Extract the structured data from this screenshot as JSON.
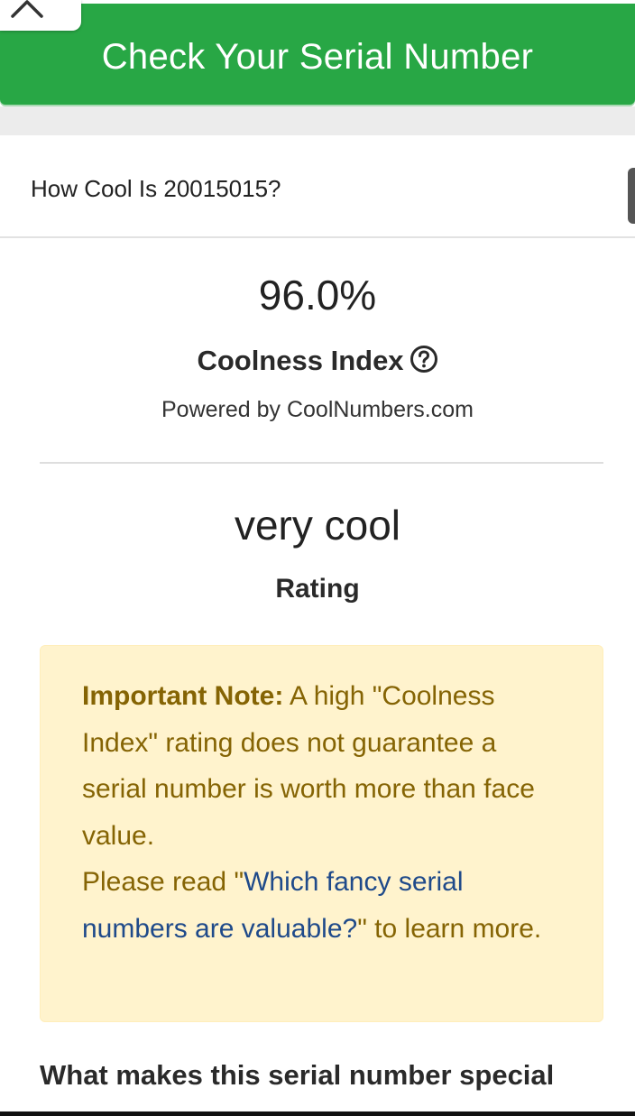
{
  "header": {
    "check_button_label": "Check Your Serial Number"
  },
  "card": {
    "title": "How Cool Is 20015015?",
    "coolness_percent": "96.0%",
    "coolness_label": "Coolness Index",
    "powered_by": "Powered by CoolNumbers.com",
    "rating_value": "very cool",
    "rating_label": "Rating"
  },
  "note": {
    "lead": "Important Note:",
    "body": " A high \"Coolness Index\" rating does not guarantee a serial number is worth more than face value.",
    "read_prefix": "Please read \"",
    "link_text": "Which fancy serial numbers are valuable?",
    "read_suffix": "\" to learn more."
  },
  "section": {
    "heading": "What makes this serial number special"
  },
  "colors": {
    "brand_green": "#28a745",
    "note_background": "#fff3cd",
    "note_text": "#856404",
    "link": "#1f4a8a"
  },
  "icons": {
    "collapse": "chevron-up-icon",
    "help": "question-circle-icon"
  }
}
